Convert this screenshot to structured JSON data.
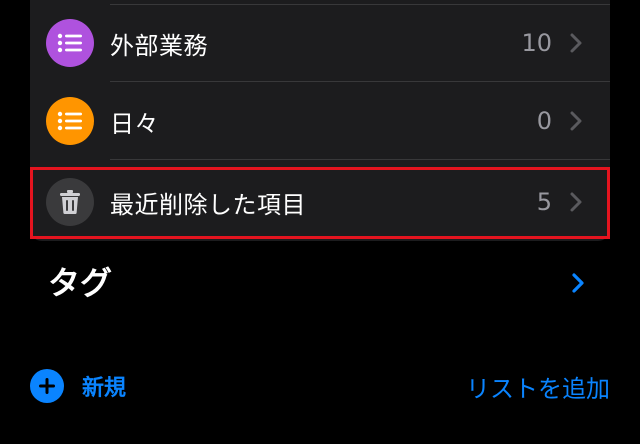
{
  "lists": [
    {
      "label": "外部業務",
      "count": "10",
      "icon": "list-bullet-icon",
      "color": "#af52de"
    },
    {
      "label": "日々",
      "count": "0",
      "icon": "list-bullet-icon",
      "color": "#ff9500"
    },
    {
      "label": "最近削除した項目",
      "count": "5",
      "icon": "trash-icon",
      "color": "#3a3a3c"
    }
  ],
  "tags": {
    "title": "タグ"
  },
  "toolbar": {
    "new_label": "新規",
    "add_list_label": "リストを追加"
  },
  "colors": {
    "accent": "#0a84ff",
    "highlight": "#e4141f",
    "background": "#000000",
    "card": "#1c1c1e"
  }
}
